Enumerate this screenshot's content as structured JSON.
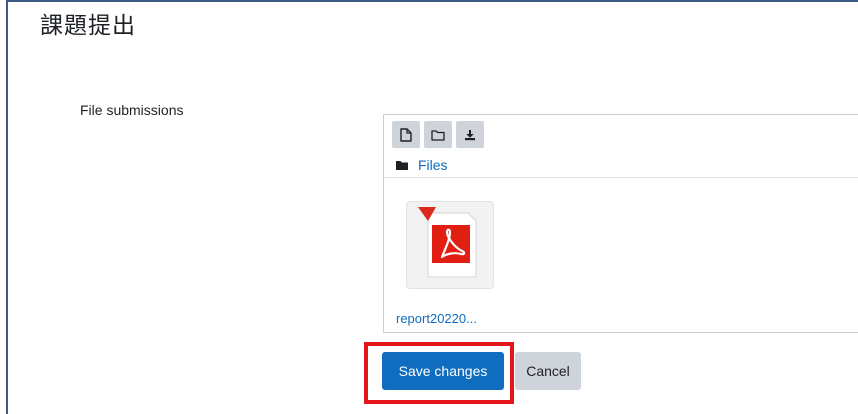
{
  "page": {
    "title": "課題提出"
  },
  "form": {
    "file_submissions_label": "File submissions"
  },
  "filemanager": {
    "toolbar": {
      "icons": [
        "add-file-icon",
        "create-folder-icon",
        "download-icon"
      ]
    },
    "path": {
      "folder_icon": "folder-icon",
      "label": "Files"
    },
    "files": [
      {
        "name": "report20220...",
        "icon": "pdf-file-icon"
      }
    ]
  },
  "actions": {
    "save_label": "Save changes",
    "cancel_label": "Cancel"
  },
  "colors": {
    "primary": "#0f6cbf",
    "secondary_button": "#ced4da",
    "highlight": "#e3161e",
    "frame_border": "#3c5a86"
  }
}
